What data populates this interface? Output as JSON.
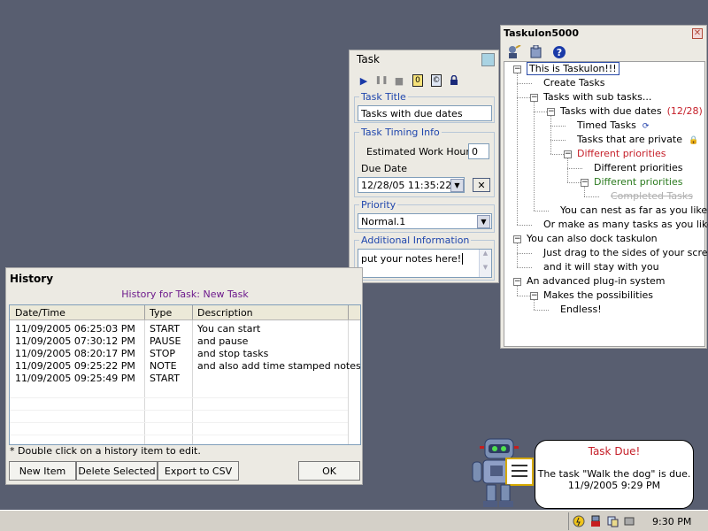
{
  "task_window": {
    "title": "Task",
    "swatch_color": "#a9d3e3",
    "toolbar": [
      {
        "name": "play-icon",
        "glyph": "▶"
      },
      {
        "name": "pause-icon",
        "glyph": "❚❚"
      },
      {
        "name": "stop-icon",
        "glyph": "■"
      },
      {
        "name": "timer-icon",
        "glyph": "⓪"
      },
      {
        "name": "copy-icon",
        "glyph": "©"
      },
      {
        "name": "lock-icon",
        "glyph": "🔒"
      }
    ],
    "task_title_label": "Task Title",
    "task_title_value": "Tasks with due dates",
    "timing_label": "Task Timing Info",
    "est_hours_label": "Estimated Work Hours",
    "est_hours_value": "0",
    "due_date_label": "Due Date",
    "due_date_value": "12/28/05 11:35:22",
    "clear_button": "✕",
    "priority_label": "Priority",
    "priority_value": "Normal.1",
    "additional_label": "Additional Information",
    "notes_value": "put your notes here!"
  },
  "taskulon": {
    "title": "Taskulon5000",
    "close_glyph": "✕",
    "toolbar": [
      "wizard-icon",
      "plugin-icon",
      "help-icon"
    ],
    "tree": [
      {
        "text": "This is Taskulon!!!",
        "level": 0,
        "selected": true,
        "expander": "−"
      },
      {
        "text": "Create Tasks",
        "level": 1
      },
      {
        "text": "Tasks with sub tasks...",
        "level": 1,
        "expander": "−"
      },
      {
        "text": "Tasks with due dates",
        "level": 2,
        "expander": "−",
        "extra": "(12/28)",
        "extra_color": "#c6202a"
      },
      {
        "text": "Timed Tasks",
        "level": 3,
        "icon": "⟳"
      },
      {
        "text": "Tasks that are private",
        "level": 3,
        "icon": "🔒"
      },
      {
        "text": "Different priorities",
        "level": 3,
        "expander": "−",
        "color": "#c6202a"
      },
      {
        "text": "Different priorities",
        "level": 4
      },
      {
        "text": "Different priorities",
        "level": 4,
        "expander": "−",
        "color": "#2a7a1e"
      },
      {
        "text": "Completed Tasks",
        "level": 5,
        "color": "#b0b0b0",
        "strike": true
      },
      {
        "text": "You can nest as far as you like",
        "level": 2
      },
      {
        "text": "Or make as many tasks as you like",
        "level": 1
      },
      {
        "text": "You can also dock taskulon",
        "level": 0,
        "expander": "−"
      },
      {
        "text": "Just drag to the sides of your screen",
        "level": 1
      },
      {
        "text": "and it will stay with you",
        "level": 1
      },
      {
        "text": "An advanced plug-in system",
        "level": 0,
        "expander": "−"
      },
      {
        "text": "Makes the possibilities",
        "level": 1,
        "expander": "−"
      },
      {
        "text": "Endless!",
        "level": 2
      }
    ]
  },
  "history": {
    "title": "History",
    "subtitle": "History for Task: New Task",
    "columns": [
      "Date/Time",
      "Type",
      "Description"
    ],
    "rows": [
      [
        "11/09/2005 06:25:03 PM",
        "START",
        "You can start"
      ],
      [
        "11/09/2005 07:30:12 PM",
        "PAUSE",
        "and pause"
      ],
      [
        "11/09/2005 08:20:17 PM",
        "STOP",
        "and stop tasks"
      ],
      [
        "11/09/2005 09:25:22 PM",
        "NOTE",
        "and also add time stamped notes!"
      ],
      [
        "11/09/2005 09:25:49 PM",
        "START",
        ""
      ]
    ],
    "note": "* Double click on a history item to edit.",
    "buttons": {
      "new": "New Item",
      "delete": "Delete Selected",
      "export": "Export to CSV",
      "ok": "OK"
    }
  },
  "notification": {
    "title": "Task Due!",
    "message": "The task \"Walk the dog\" is due.",
    "time": "11/9/2005 9:29 PM"
  },
  "taskbar": {
    "clock": "9:30 PM"
  }
}
